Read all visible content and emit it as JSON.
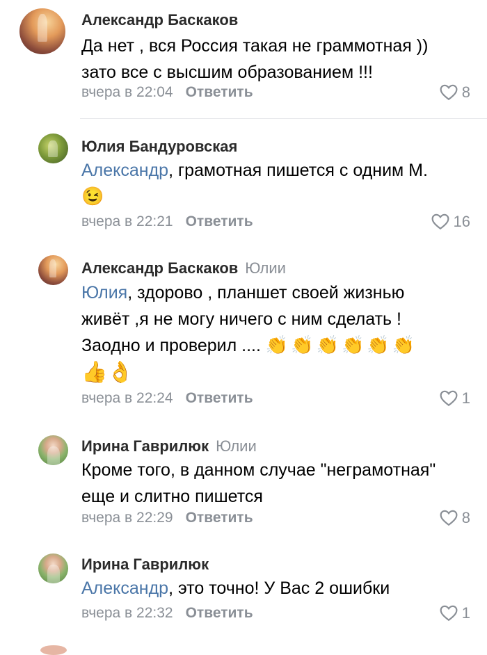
{
  "comments": [
    {
      "author": "Александр Баскаков",
      "reply_to": "",
      "lines": [
        "Да нет , вся Россия такая не граммотная ))",
        "зато все с высшим образованием !!!"
      ],
      "time": "вчера в 22:04",
      "reply_label": "Ответить",
      "likes": "8"
    },
    {
      "author": "Юлия Бандуровская",
      "reply_to": "",
      "mention": "Александр",
      "rest": ", грамотная пишется с одним М.",
      "emoji": "😉",
      "time": "вчера в 22:21",
      "reply_label": "Ответить",
      "likes": "16"
    },
    {
      "author": "Александр Баскаков",
      "reply_to": "Юлии",
      "mention": "Юлия",
      "rest": ", здорово , планшет своей жизнью",
      "line2": "живёт ,я не могу ничего с ним сделать !",
      "line3": "Заодно и проверил ....",
      "line3_emoji": "👏👏👏👏👏👏",
      "emoji_line": "👍👌",
      "time": "вчера в 22:24",
      "reply_label": "Ответить",
      "likes": "1"
    },
    {
      "author": "Ирина Гаврилюк",
      "reply_to": "Юлии",
      "lines": [
        "Кроме того, в данном случае \"неграмотная\"",
        "еще и слитно пишется"
      ],
      "time": "вчера в 22:29",
      "reply_label": "Ответить",
      "likes": "8"
    },
    {
      "author": "Ирина Гаврилюк",
      "reply_to": "",
      "mention": "Александр",
      "rest": ", это точно! У Вас 2 ошибки",
      "time": "вчера в 22:32",
      "reply_label": "Ответить",
      "likes": "1"
    }
  ],
  "icons": {
    "like": "heart-outline-icon"
  },
  "colors": {
    "mention": "#4a76a8",
    "meta": "#8a8f96",
    "name": "#2b2b2b"
  }
}
